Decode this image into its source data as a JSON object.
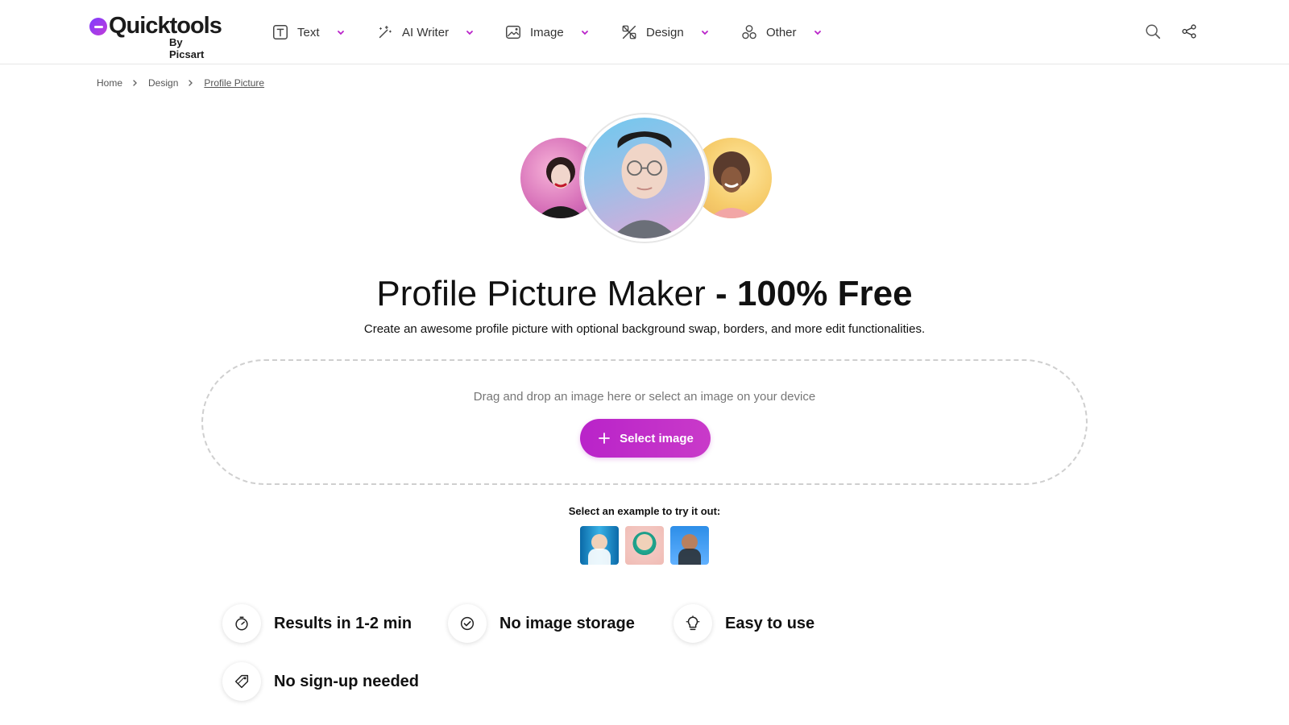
{
  "app": {
    "logo_title": "Quicktools",
    "logo_subtitle": "By Picsart"
  },
  "nav": {
    "items": [
      {
        "label": "Text",
        "icon": "text-box-icon"
      },
      {
        "label": "AI Writer",
        "icon": "magic-wand-icon"
      },
      {
        "label": "Image",
        "icon": "image-edit-icon"
      },
      {
        "label": "Design",
        "icon": "design-tools-icon"
      },
      {
        "label": "Other",
        "icon": "shapes-icon"
      }
    ]
  },
  "header_icons": {
    "search": "search-icon",
    "share": "share-icon"
  },
  "breadcrumb": [
    "Home",
    "Design",
    "Profile Picture"
  ],
  "hero": {
    "title_main": "Profile Picture Maker ",
    "title_strong": "- 100% Free",
    "subtitle": "Create an awesome profile picture with optional background swap, borders, and more edit functionalities."
  },
  "upload": {
    "drop_text": "Drag and drop an image here or select an image on your device",
    "button_label": "Select image"
  },
  "examples": {
    "label": "Select an example to try it out:"
  },
  "features": [
    {
      "label": "Results in 1-2 min",
      "icon": "stopwatch-icon"
    },
    {
      "label": "No image storage",
      "icon": "check-circle-icon"
    },
    {
      "label": "Easy to use",
      "icon": "lightbulb-icon"
    },
    {
      "label": "No sign-up needed",
      "icon": "tag-icon"
    }
  ],
  "colors": {
    "accent": "#c026d3",
    "border": "#e6e6e6",
    "text": "#111111"
  }
}
